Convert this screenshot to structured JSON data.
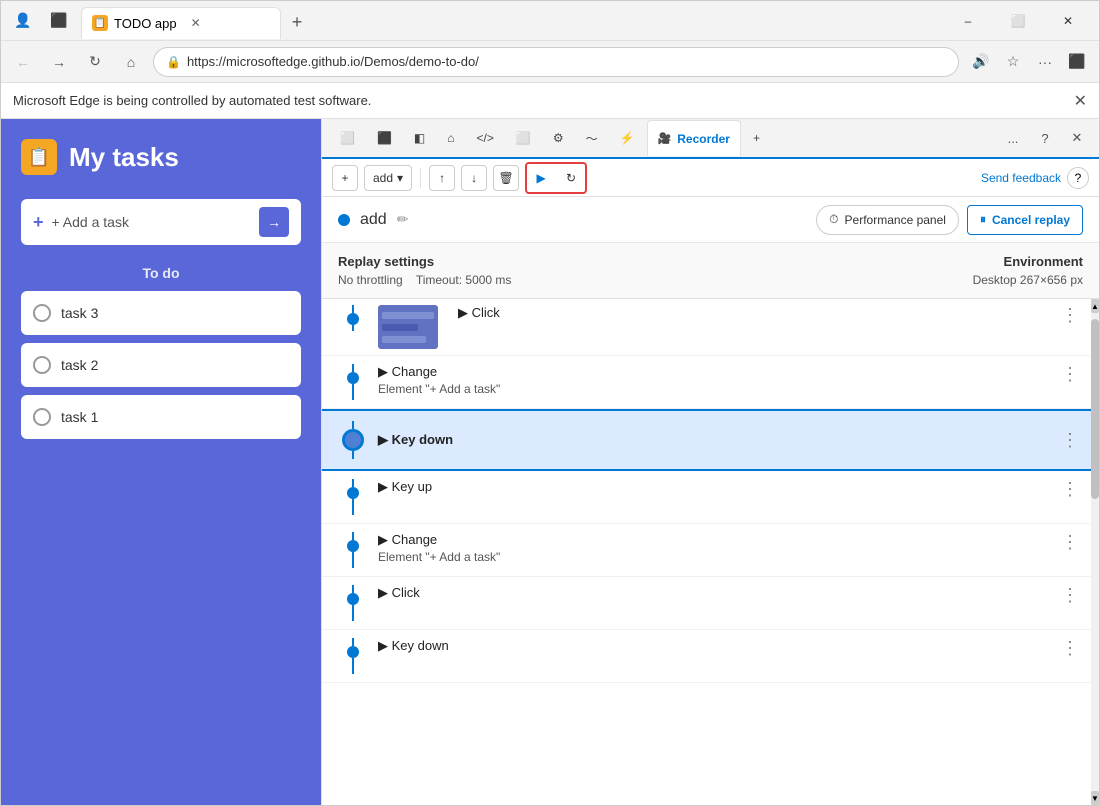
{
  "browser": {
    "tab_title": "TODO app",
    "tab_icon": "📋",
    "url": "https://microsoftedge.github.io/Demos/demo-to-do/",
    "info_bar_text": "Microsoft Edge is being controlled by automated test software.",
    "new_tab_label": "+",
    "nav": {
      "back": "←",
      "forward": "→",
      "refresh": "↻",
      "home": "⌂"
    },
    "window_controls": {
      "minimize": "–",
      "maximize": "⬜",
      "close": "✕"
    }
  },
  "todo_app": {
    "title": "My tasks",
    "icon": "📋",
    "add_task_placeholder": "+ Add a task",
    "section_label": "To do",
    "tasks": [
      {
        "id": "task3",
        "label": "task 3"
      },
      {
        "id": "task2",
        "label": "task 2"
      },
      {
        "id": "task1",
        "label": "task 1"
      }
    ]
  },
  "devtools": {
    "tabs": [
      {
        "id": "elements",
        "label": "⬜",
        "active": false
      },
      {
        "id": "console",
        "label": "⬛",
        "active": false
      },
      {
        "id": "sources",
        "label": "◧",
        "active": false
      },
      {
        "id": "home",
        "label": "⌂",
        "active": false
      },
      {
        "id": "html",
        "label": "</>",
        "active": false
      },
      {
        "id": "screen",
        "label": "⬜",
        "active": false
      },
      {
        "id": "debug",
        "label": "⚙",
        "active": false
      },
      {
        "id": "network",
        "label": "📶",
        "active": false
      },
      {
        "id": "accessibility",
        "label": "⚡",
        "active": false
      },
      {
        "id": "recorder",
        "label": "Recorder",
        "active": true
      }
    ],
    "more_btn": "...",
    "help_btn": "?",
    "close_btn": "✕"
  },
  "recorder": {
    "toolbar": {
      "add_btn": "+",
      "add_label": "add",
      "up_btn": "↑",
      "down_btn": "↓",
      "delete_btn": "🗑",
      "play_btn": "▶",
      "replay_btn": "↻",
      "send_feedback": "Send feedback",
      "help_btn": "?"
    },
    "header": {
      "step_name": "add",
      "edit_icon": "✏",
      "performance_panel_btn": "Performance panel",
      "cancel_replay_btn": "Cancel replay"
    },
    "settings": {
      "title": "Replay settings",
      "throttling_label": "No throttling",
      "timeout_label": "Timeout: 5000 ms",
      "env_title": "Environment",
      "env_detail": "Desktop  267×656 px"
    },
    "steps": [
      {
        "id": "step-click",
        "has_thumb": true,
        "action": "▶ Click",
        "detail": "",
        "active": false,
        "connector": true
      },
      {
        "id": "step-change-1",
        "has_thumb": false,
        "action": "▶ Change",
        "detail": "Element \"+  Add a task\"",
        "active": false,
        "connector": true
      },
      {
        "id": "step-keydown-1",
        "has_thumb": false,
        "action": "▶ Key down",
        "detail": "",
        "active": true,
        "connector": true
      },
      {
        "id": "step-keyup",
        "has_thumb": false,
        "action": "▶ Key up",
        "detail": "",
        "active": false,
        "connector": true
      },
      {
        "id": "step-change-2",
        "has_thumb": false,
        "action": "▶ Change",
        "detail": "Element \"+  Add a task\"",
        "active": false,
        "connector": true
      },
      {
        "id": "step-click-2",
        "has_thumb": false,
        "action": "▶ Click",
        "detail": "",
        "active": false,
        "connector": true
      },
      {
        "id": "step-keydown-2",
        "has_thumb": false,
        "action": "▶ Key down",
        "detail": "",
        "active": false,
        "connector": true
      }
    ]
  }
}
